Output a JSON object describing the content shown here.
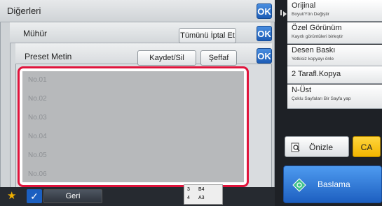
{
  "dialog_main": {
    "title": "Diğerleri",
    "ok_label": "OK"
  },
  "dialog_muhur": {
    "title": "Mühür",
    "cancel_all_label": "Tümünü İptal Et",
    "ok_label": "OK"
  },
  "dialog_preset": {
    "title": "Preset Metin",
    "save_delete_label": "Kaydet/Sil",
    "transparent_label": "Şeffaf",
    "ok_label": "OK",
    "items": [
      "No.01",
      "No.02",
      "No.03",
      "No.04",
      "No.05",
      "No.06"
    ]
  },
  "right_panel": {
    "items": [
      {
        "title": "Orijinal",
        "sub": "Boyut/Yön Değiştir"
      },
      {
        "title": "Özel Görünüm",
        "sub": "Kayıtlı görüntüleri birleştir"
      },
      {
        "title": "Desen Baskı",
        "sub": "Yetkisiz kopyayı önle"
      },
      {
        "title": "2 Tarafl.Kopya",
        "sub": ""
      },
      {
        "title": "N-Üst",
        "sub": "Çoklu Sayfaları Bir Sayfa yap"
      }
    ],
    "preview_label": "Önizle",
    "ca_label": "CA",
    "start_label": "Baslama"
  },
  "bottom": {
    "back_label": "Geri",
    "tray_number_1": "3",
    "tray_size_1": "B4",
    "tray_number_2": "4",
    "tray_size_2": "A3"
  },
  "colors": {
    "highlight": "#e0143c",
    "accent_blue": "#1c5cb6",
    "ca_yellow": "#f2b500"
  }
}
